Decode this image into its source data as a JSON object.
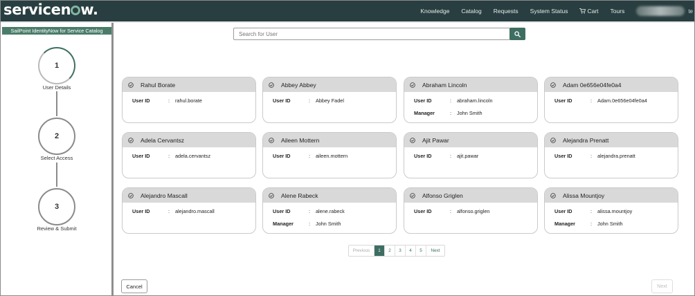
{
  "header": {
    "logo": "servicenow.",
    "nav": [
      "Knowledge",
      "Catalog",
      "Requests",
      "System Status"
    ],
    "cart_label": "Cart",
    "tours_label": "Tours",
    "user_suffix": "te"
  },
  "sidebar": {
    "title": "SailPoint IdentityNow for Service Catalog",
    "steps": [
      {
        "number": "1",
        "label": "User Details"
      },
      {
        "number": "2",
        "label": "Select Access"
      },
      {
        "number": "3",
        "label": "Review & Submit"
      }
    ]
  },
  "search": {
    "placeholder": "Search for User"
  },
  "labels": {
    "user_id": "User ID",
    "manager": "Manager",
    "colon": ":"
  },
  "users": [
    {
      "name": "Rahul Borate",
      "user_id": "rahul.borate",
      "manager": ""
    },
    {
      "name": "Abbey Abbey",
      "user_id": "Abbey Fadel",
      "manager": ""
    },
    {
      "name": "Abraham Lincoln",
      "user_id": "abraham.lincoln",
      "manager": "John Smith"
    },
    {
      "name": "Adam 0e656e04fe0a4",
      "user_id": "Adam.0e656e04fe0a4",
      "manager": ""
    },
    {
      "name": "Adela Cervantsz",
      "user_id": "adela.cervantsz",
      "manager": ""
    },
    {
      "name": "Aileen Mottern",
      "user_id": "aileen.mottern",
      "manager": ""
    },
    {
      "name": "Ajit Pawar",
      "user_id": "ajit.pawar",
      "manager": ""
    },
    {
      "name": "Alejandra Prenatt",
      "user_id": "alejandra.prenatt",
      "manager": ""
    },
    {
      "name": "Alejandro Mascall",
      "user_id": "alejandro.mascall",
      "manager": ""
    },
    {
      "name": "Alene Rabeck",
      "user_id": "alene.rabeck",
      "manager": "John Smith"
    },
    {
      "name": "Alfonso Griglen",
      "user_id": "alfonso.griglen",
      "manager": ""
    },
    {
      "name": "Alissa Mountjoy",
      "user_id": "alissa.mountjoy",
      "manager": "John Smith"
    }
  ],
  "pagination": {
    "previous": "Previous",
    "pages": [
      "1",
      "2",
      "3",
      "4",
      "5"
    ],
    "current": "1",
    "next": "Next"
  },
  "footer": {
    "cancel": "Cancel",
    "next": "Next"
  },
  "colors": {
    "header_bg": "#293e40",
    "accent": "#3e6e62",
    "card_header": "#d9d9d9"
  }
}
